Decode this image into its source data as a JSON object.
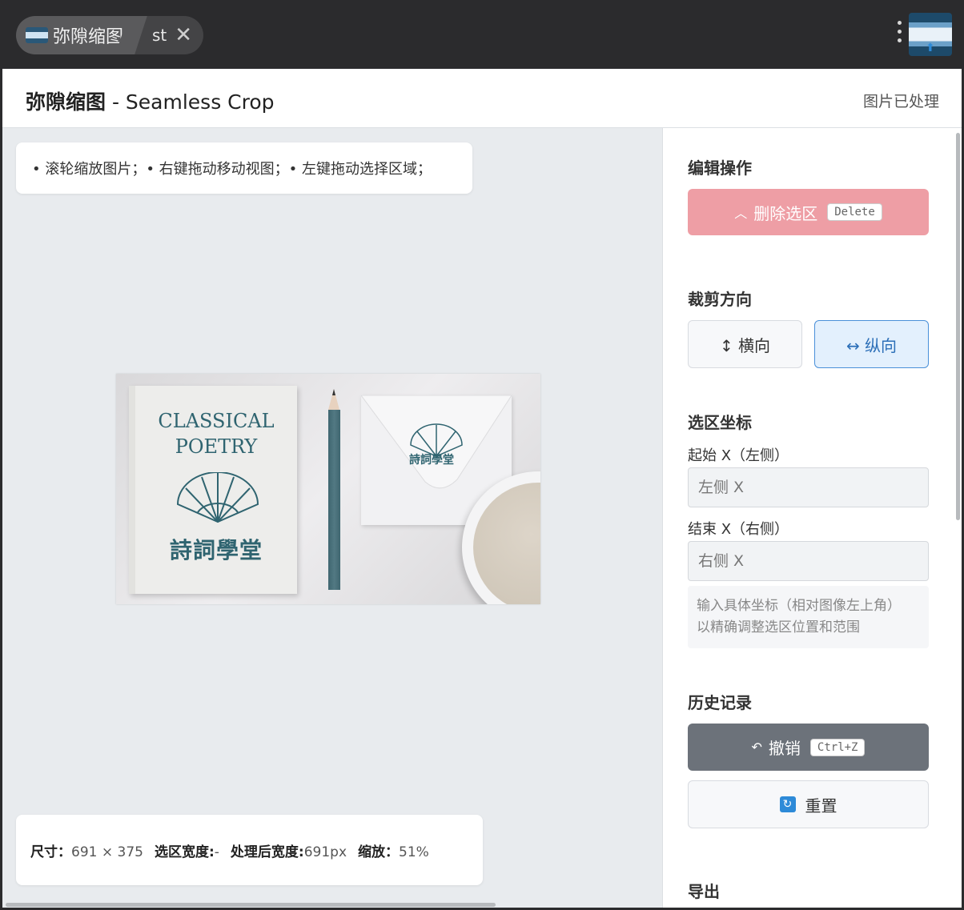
{
  "tabs": {
    "main_label": "弥隙缩图",
    "sub_label": "st",
    "close_glyph": "✕"
  },
  "header": {
    "title_bold": "弥隙缩图",
    "title_rest": " - Seamless Crop",
    "status": "图片已处理"
  },
  "canvas": {
    "tips": "• 滚轮缩放图片；• 右键拖动移动视图；• 左键拖动选择区域；",
    "image": {
      "book_title_line1": "CLASSICAL",
      "book_title_line2": "POETRY",
      "book_cn": "詩詞學堂",
      "envelope_cn": "詩詞學堂"
    },
    "info": {
      "size_label": "尺寸：",
      "size_value": "691 × 375",
      "selection_label": "选区宽度:",
      "selection_value": "-",
      "processed_label": "处理后宽度:",
      "processed_value": "691px",
      "zoom_label": "缩放：",
      "zoom_value": "51%"
    }
  },
  "panel": {
    "edit": {
      "title": "编辑操作",
      "delete_label": "删除选区",
      "delete_key": "Delete"
    },
    "direction": {
      "title": "裁剪方向",
      "horizontal_label": "↕ 横向",
      "vertical_label": "↔ 纵向",
      "selected": "vertical"
    },
    "coords": {
      "title": "选区坐标",
      "start_label": "起始 X（左侧）",
      "start_placeholder": "左侧 X",
      "end_label": "结束 X（右侧）",
      "end_placeholder": "右侧 X",
      "hint_line1": "输入具体坐标（相对图像左上角）",
      "hint_line2": "以精确调整选区位置和范围"
    },
    "history": {
      "title": "历史记录",
      "undo_label": "撤销",
      "undo_key": "Ctrl+Z",
      "reset_label": "重置"
    },
    "export": {
      "title": "导出"
    }
  },
  "colors": {
    "delete_button": "#ee9ea5",
    "selected_direction": "#4a90d9",
    "undo_button": "#6c727a"
  }
}
